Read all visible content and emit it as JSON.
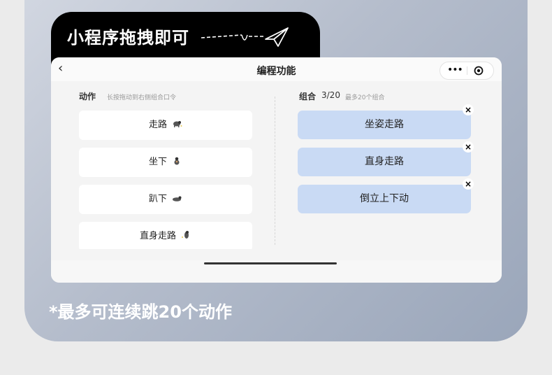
{
  "banner": {
    "title": "小程序拖拽即可"
  },
  "navbar": {
    "title": "编程功能",
    "more_glyph": "•••"
  },
  "actions": {
    "label": "动作",
    "hint": "长按拖动到右侧组合口令",
    "items": [
      {
        "label": "走路",
        "icon": "dog-walking-icon"
      },
      {
        "label": "坐下",
        "icon": "dog-sitting-icon"
      },
      {
        "label": "趴下",
        "icon": "dog-lying-icon"
      },
      {
        "label": "直身走路",
        "icon": "dog-upright-icon"
      }
    ]
  },
  "combo": {
    "label": "组合",
    "count": "3/20",
    "hint": "最多20个组合",
    "remove_glyph": "×",
    "items": [
      {
        "label": "坐姿走路"
      },
      {
        "label": "直身走路"
      },
      {
        "label": "倒立上下动"
      }
    ]
  },
  "footnote": "*最多可连续跳20个动作",
  "colors": {
    "combo_item_bg": "#c9daf4",
    "banner_bg": "#000000"
  }
}
